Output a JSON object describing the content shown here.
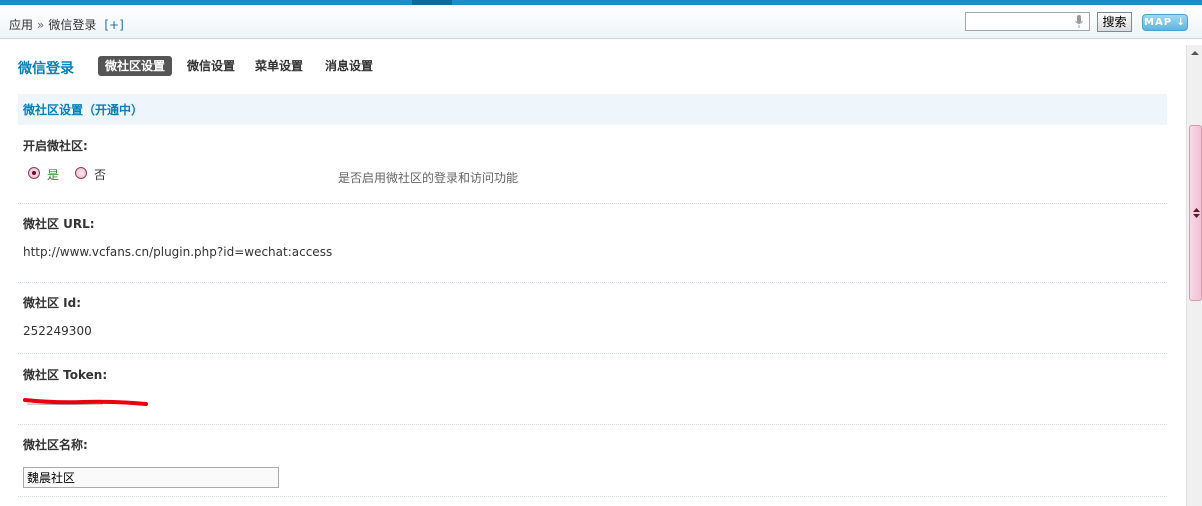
{
  "breadcrumb": {
    "root": "应用",
    "separator": "»",
    "current": "微信登录",
    "add": "[+]"
  },
  "header": {
    "search_button": "搜索",
    "map_button": "MAP ↓",
    "search_value": ""
  },
  "nav": {
    "title": "微信登录",
    "tabs": [
      {
        "label": "微社区设置",
        "active": true
      },
      {
        "label": "微信设置",
        "active": false
      },
      {
        "label": "菜单设置",
        "active": false
      },
      {
        "label": "消息设置",
        "active": false
      }
    ]
  },
  "section": {
    "title": "微社区设置（开通中）"
  },
  "form": {
    "enable": {
      "label": "开启微社区:",
      "yes": "是",
      "no": "否",
      "selected": "是",
      "hint": "是否启用微社区的登录和访问功能"
    },
    "url": {
      "label": "微社区 URL:",
      "value": "http://www.vcfans.cn/plugin.php?id=wechat:access"
    },
    "id": {
      "label": "微社区 Id:",
      "value": "252249300"
    },
    "token": {
      "label": "微社区 Token:",
      "redacted": true
    },
    "name": {
      "label": "微社区名称:",
      "value": "魏晨社区"
    }
  },
  "colors": {
    "accent": "#0a7fb8",
    "top_bar": "#1a8fc7",
    "section_bg": "#eef5fb",
    "redaction": "#e8000e"
  },
  "icons": {
    "mic": "microphone-icon",
    "radio": "radio-icon"
  }
}
